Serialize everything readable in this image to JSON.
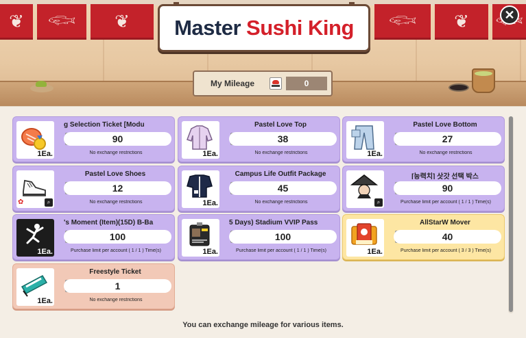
{
  "header": {
    "title_part1": "Master",
    "title_part2": "Sushi King",
    "close_label": "✕"
  },
  "mileage": {
    "label": "My Mileage",
    "value": "0"
  },
  "items": [
    {
      "name": "g Selection Ticket        [Modu",
      "qty": "1Ea.",
      "price": "90",
      "limit": "No exchange restrictions",
      "style": "purple",
      "icon": "sushi-medal-icon"
    },
    {
      "name": "Pastel Love Top",
      "qty": "1Ea.",
      "price": "38",
      "limit": "No exchange restrictions",
      "style": "purple",
      "icon": "jacket-icon"
    },
    {
      "name": "Pastel Love Bottom",
      "qty": "1Ea.",
      "price": "27",
      "limit": "No exchange restrictions",
      "style": "purple",
      "icon": "jeans-icon"
    },
    {
      "name": "Pastel Love Shoes",
      "qty": "",
      "price": "12",
      "limit": "No exchange restrictions",
      "style": "purple",
      "icon": "sneaker-icon"
    },
    {
      "name": "Campus Life Outfit Package",
      "qty": "1Ea.",
      "price": "45",
      "limit": "No exchange restrictions",
      "style": "purple",
      "icon": "outfit-icon"
    },
    {
      "name": "[능력치] 삿갓 선택 박스",
      "qty": "",
      "price": "90",
      "limit": "Purchase limit per account ( 1 / 1 ) Time(s)",
      "style": "purple",
      "icon": "straw-hat-icon"
    },
    {
      "name": "'s Moment (Item)(15D)    B-Ba",
      "qty": "1Ea.",
      "price": "100",
      "limit": "Purchase limit per account ( 1 / 1 ) Time(s)",
      "style": "purple",
      "icon": "dunk-player-icon"
    },
    {
      "name": "5 Days)     Stadium VVIP Pass",
      "qty": "1Ea.",
      "price": "100",
      "limit": "Purchase limit per account ( 1 / 1 ) Time(s)",
      "style": "purple",
      "icon": "vip-pass-icon"
    },
    {
      "name": "AllStarW Mover",
      "qty": "1Ea.",
      "price": "40",
      "limit": "Purchase limit per account ( 3 / 3 ) Time(s)",
      "style": "gold",
      "icon": "card-pack-icon"
    },
    {
      "name": "Freestyle Ticket",
      "qty": "1Ea.",
      "price": "1",
      "limit": "No exchange restrictions",
      "style": "peach",
      "icon": "freestyle-ticket-icon"
    }
  ],
  "footer": {
    "message": "You can exchange mileage for various items."
  },
  "colors": {
    "card_purple": "#c8b3ef",
    "card_gold": "#fde6a3",
    "card_peach": "#f2c9b7",
    "title_red": "#d4202a",
    "title_navy": "#1e2b44"
  }
}
